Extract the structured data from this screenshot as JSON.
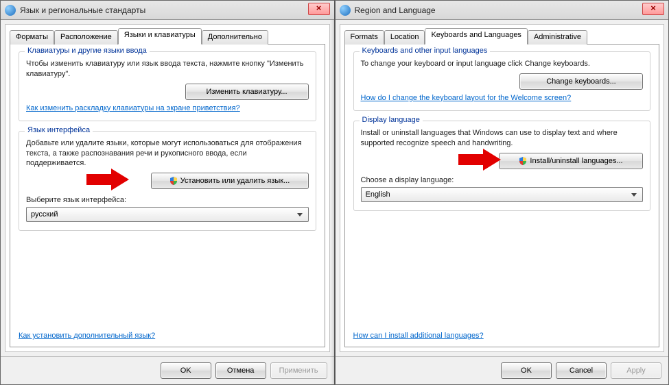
{
  "left": {
    "title": "Язык и региональные стандарты",
    "tabs": [
      "Форматы",
      "Расположение",
      "Языки и клавиатуры",
      "Дополнительно"
    ],
    "active_tab": 2,
    "group1": {
      "legend": "Клавиатуры и другие языки ввода",
      "desc": "Чтобы изменить клавиатуру или язык ввода текста, нажмите кнопку \"Изменить клавиатуру\".",
      "button": "Изменить клавиатуру...",
      "link": "Как изменить раскладку клавиатуры на экране приветствия?"
    },
    "group2": {
      "legend": "Язык интерфейса",
      "desc": "Добавьте или удалите языки, которые могут использоваться для отображения текста, а также распознавания речи и рукописного ввода, если                       поддерживается.",
      "button": "Установить или удалить язык...",
      "choose_label": "Выберите язык интерфейса:",
      "combo_value": "русский"
    },
    "bottom_link": "Как установить дополнительный язык?",
    "buttons": {
      "ok": "OK",
      "cancel": "Отмена",
      "apply": "Применить"
    }
  },
  "right": {
    "title": "Region and Language",
    "tabs": [
      "Formats",
      "Location",
      "Keyboards and Languages",
      "Administrative"
    ],
    "active_tab": 2,
    "group1": {
      "legend": "Keyboards and other input languages",
      "desc": "To change your keyboard or input language click Change keyboards.",
      "button": "Change keyboards...",
      "link": "How do I change the keyboard layout for the Welcome screen?"
    },
    "group2": {
      "legend": "Display language",
      "desc": "Install or uninstall languages that Windows can use to display text and where supported recognize speech and handwriting.",
      "button": "Install/uninstall languages...",
      "choose_label": "Choose a display language:",
      "combo_value": "English"
    },
    "bottom_link": "How can I install additional languages?",
    "buttons": {
      "ok": "OK",
      "cancel": "Cancel",
      "apply": "Apply"
    }
  }
}
